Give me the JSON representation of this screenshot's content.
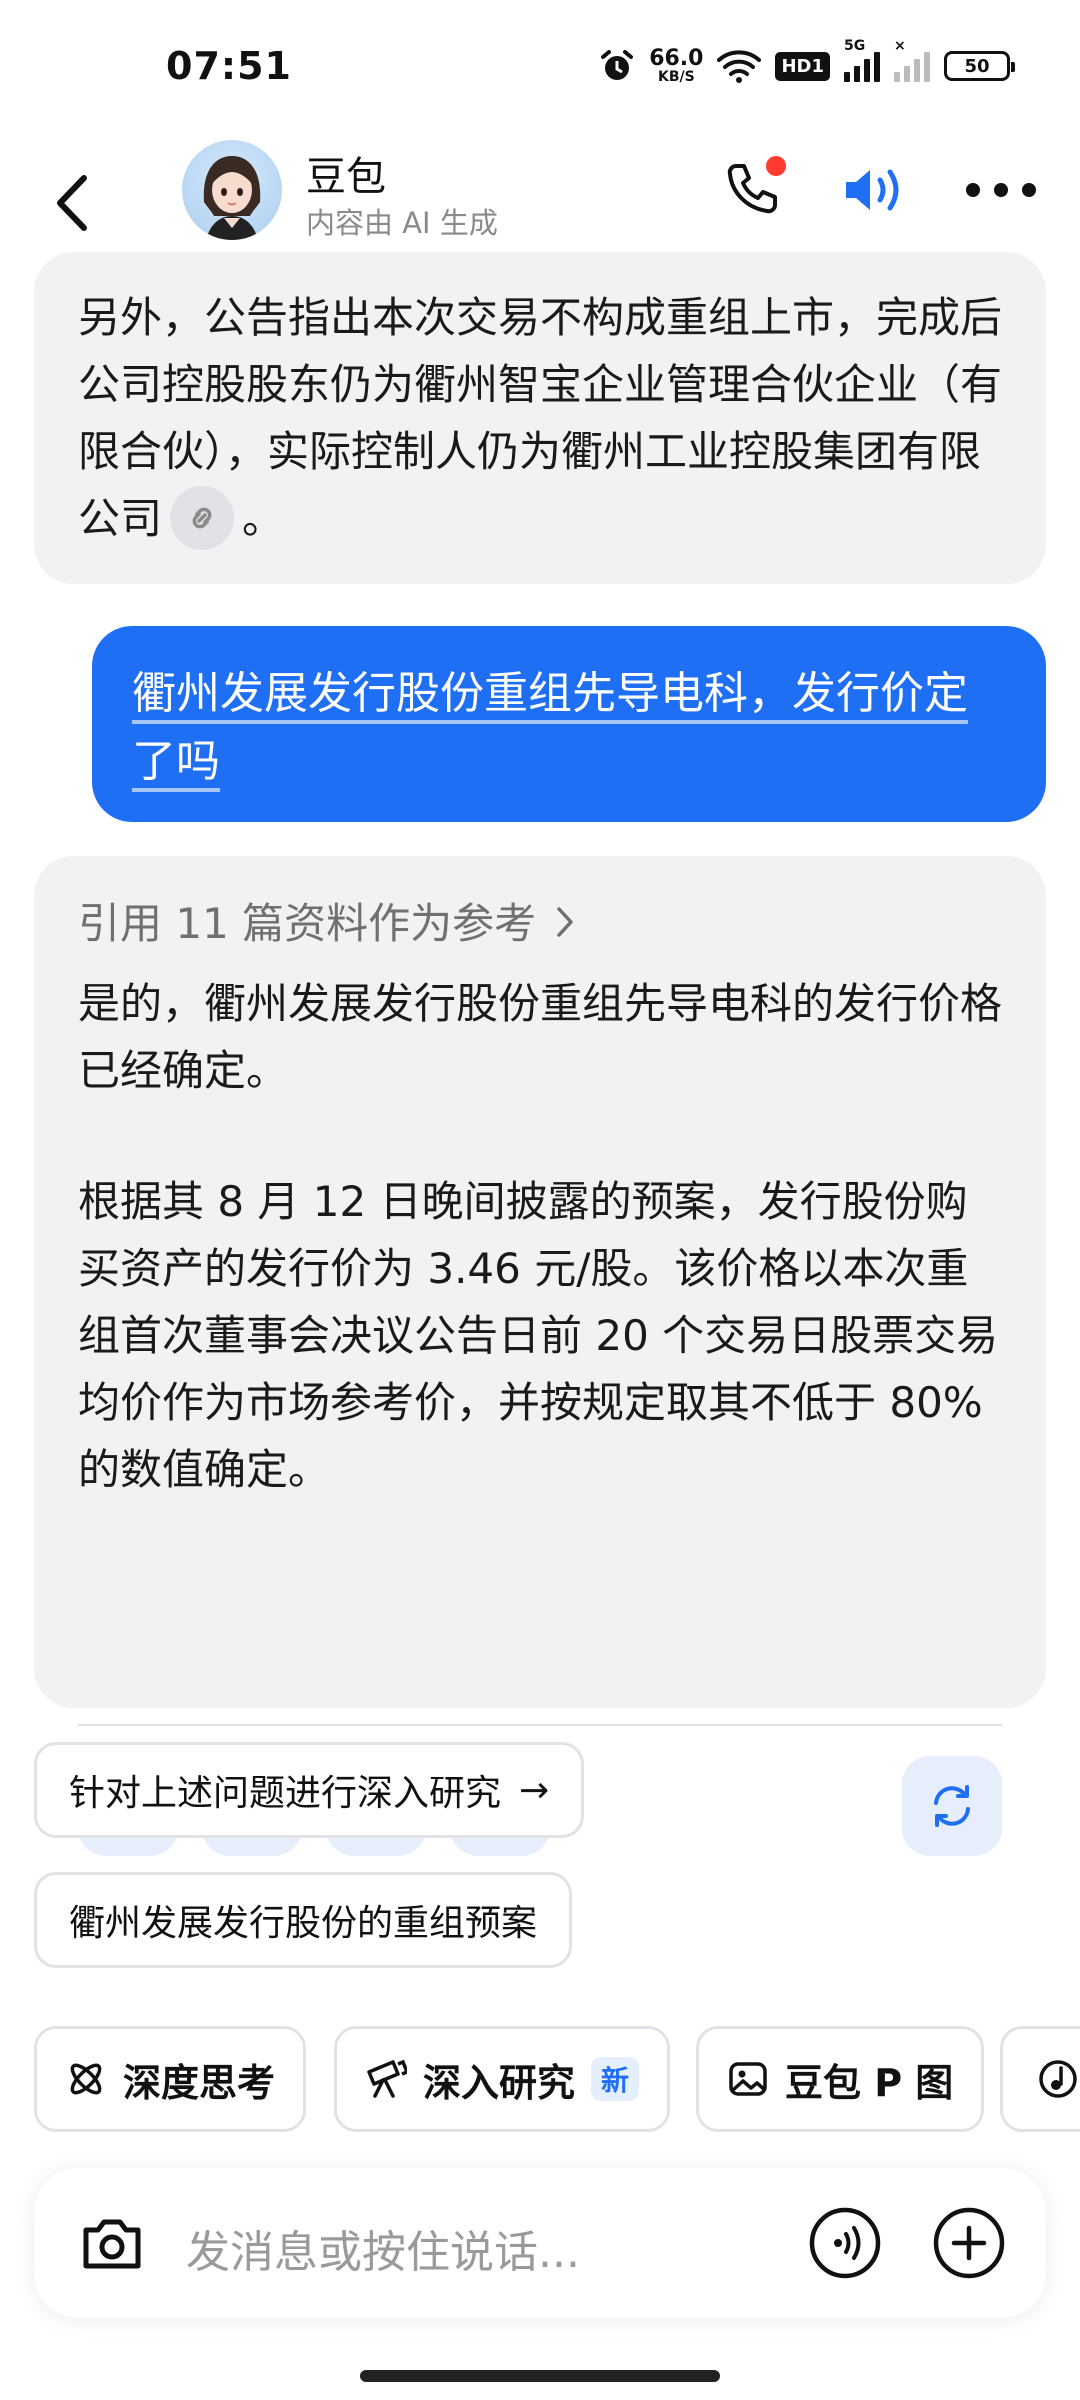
{
  "status_bar": {
    "time": "07:51",
    "net_speed_value": "66.0",
    "net_speed_unit": "KB/S",
    "hd_badge": "HD1",
    "sim1_tag": "5G",
    "sim2_tag": "×",
    "battery": "50"
  },
  "header": {
    "title": "豆包",
    "subtitle": "内容由 AI 生成"
  },
  "messages": {
    "ai_1": {
      "text": "另外，公告指出本次交易不构成重组上市，完成后公司控股股东仍为衢州智宝企业管理合伙企业（有限合伙），实际控制人仍为衢州工业控股集团有限公司",
      "suffix": "。"
    },
    "user_1": {
      "text": "衢州发展发行股份重组先导电科，发行价定了吗"
    },
    "ai_2": {
      "reference_label": "引用 11 篇资料作为参考",
      "para_1": "是的，衢州发展发行股份重组先导电科的发行价格已经确定。",
      "para_2": "根据其 8 月 12 日晚间披露的预案，发行股份购买资产的发行价为 3.46 元/股。该价格以本次重组首次董事会决议公告日前 20 个交易日股票交易均价作为市场参考价，并按规定取其不低于 80% 的数值确定。"
    }
  },
  "suggestions": [
    {
      "label": "针对上述问题进行深入研究",
      "arrow": "→"
    },
    {
      "label": "衢州发展发行股份的重组预案"
    }
  ],
  "feature_chips": [
    {
      "label": "深度思考"
    },
    {
      "label": "深入研究",
      "badge": "新"
    },
    {
      "label": "豆包 P 图"
    }
  ],
  "input": {
    "placeholder": "发消息或按住说话..."
  },
  "colors": {
    "accent": "#1f6ff5",
    "bubble_ai": "#f2f2f4",
    "action_bg": "#e6eefb"
  }
}
